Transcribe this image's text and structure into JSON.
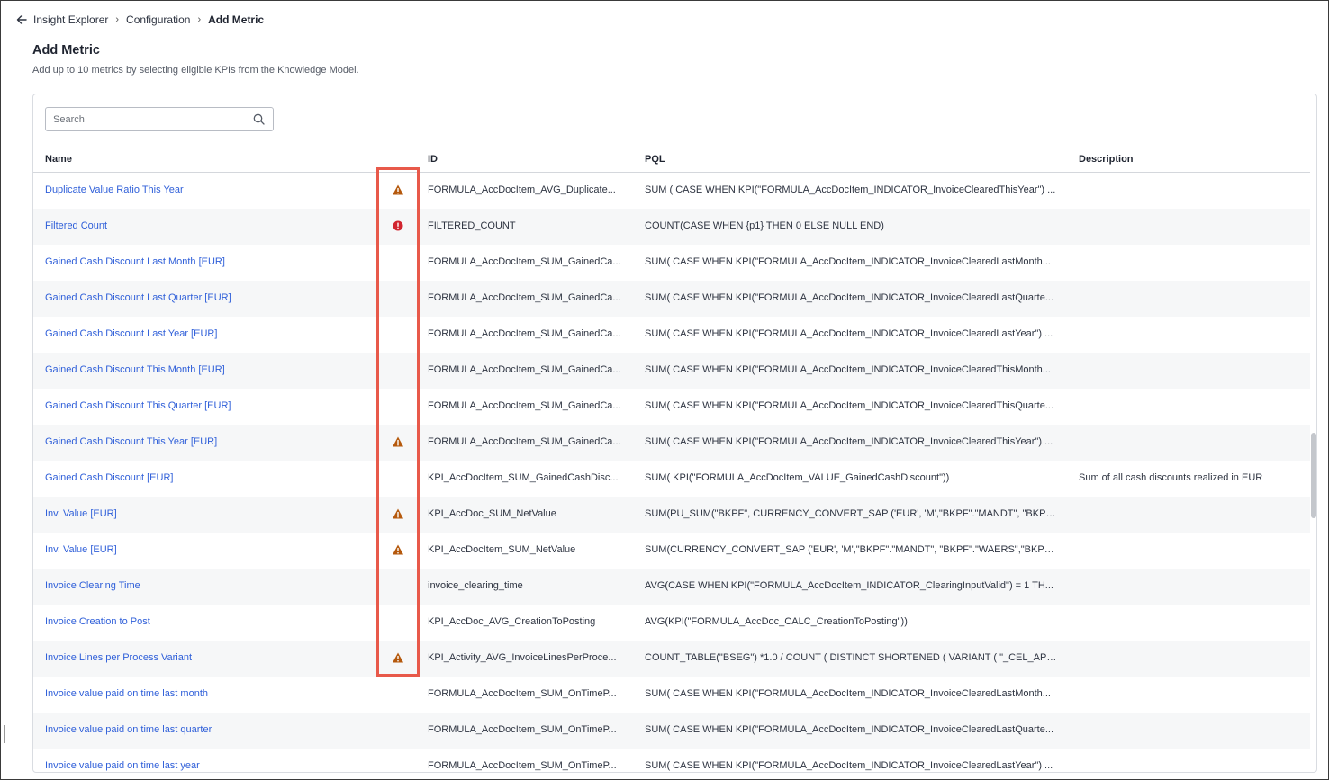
{
  "breadcrumb": {
    "items": [
      "Insight Explorer",
      "Configuration",
      "Add Metric"
    ]
  },
  "header": {
    "title": "Add Metric",
    "subtitle": "Add up to 10 metrics by selecting eligible KPIs from the Knowledge Model."
  },
  "search": {
    "placeholder": "Search",
    "value": ""
  },
  "table": {
    "columns": [
      "Name",
      "ID",
      "PQL",
      "Description"
    ],
    "rows": [
      {
        "name": "Duplicate Value Ratio This Year",
        "status": "warning",
        "id": "FORMULA_AccDocItem_AVG_Duplicate...",
        "pql": "SUM ( CASE WHEN KPI(\"FORMULA_AccDocItem_INDICATOR_InvoiceClearedThisYear\") ...",
        "description": ""
      },
      {
        "name": "Filtered Count",
        "status": "error",
        "id": "FILTERED_COUNT",
        "pql": "COUNT(CASE WHEN {p1} THEN 0 ELSE NULL END)",
        "description": ""
      },
      {
        "name": "Gained Cash Discount Last Month [EUR]",
        "status": "",
        "id": "FORMULA_AccDocItem_SUM_GainedCa...",
        "pql": "SUM( CASE WHEN KPI(\"FORMULA_AccDocItem_INDICATOR_InvoiceClearedLastMonth...",
        "description": ""
      },
      {
        "name": "Gained Cash Discount Last Quarter [EUR]",
        "status": "",
        "id": "FORMULA_AccDocItem_SUM_GainedCa...",
        "pql": "SUM( CASE WHEN KPI(\"FORMULA_AccDocItem_INDICATOR_InvoiceClearedLastQuarte...",
        "description": ""
      },
      {
        "name": "Gained Cash Discount Last Year [EUR]",
        "status": "",
        "id": "FORMULA_AccDocItem_SUM_GainedCa...",
        "pql": "SUM( CASE WHEN KPI(\"FORMULA_AccDocItem_INDICATOR_InvoiceClearedLastYear\") ...",
        "description": ""
      },
      {
        "name": "Gained Cash Discount This Month [EUR]",
        "status": "",
        "id": "FORMULA_AccDocItem_SUM_GainedCa...",
        "pql": "SUM( CASE WHEN KPI(\"FORMULA_AccDocItem_INDICATOR_InvoiceClearedThisMonth...",
        "description": ""
      },
      {
        "name": "Gained Cash Discount This Quarter [EUR]",
        "status": "",
        "id": "FORMULA_AccDocItem_SUM_GainedCa...",
        "pql": "SUM( CASE WHEN KPI(\"FORMULA_AccDocItem_INDICATOR_InvoiceClearedThisQuarte...",
        "description": ""
      },
      {
        "name": "Gained Cash Discount This Year [EUR]",
        "status": "warning",
        "id": "FORMULA_AccDocItem_SUM_GainedCa...",
        "pql": "SUM( CASE WHEN KPI(\"FORMULA_AccDocItem_INDICATOR_InvoiceClearedThisYear\") ...",
        "description": ""
      },
      {
        "name": "Gained Cash Discount [EUR]",
        "status": "",
        "id": "KPI_AccDocItem_SUM_GainedCashDisc...",
        "pql": "SUM( KPI(\"FORMULA_AccDocItem_VALUE_GainedCashDiscount\"))",
        "description": "Sum of all cash discounts realized in EUR"
      },
      {
        "name": "Inv. Value [EUR]",
        "status": "warning",
        "id": "KPI_AccDoc_SUM_NetValue",
        "pql": "SUM(PU_SUM(\"BKPF\", CURRENCY_CONVERT_SAP ('EUR', 'M',\"BKPF\".\"MANDT\", \"BKPF\".\"...",
        "description": ""
      },
      {
        "name": "Inv. Value [EUR]",
        "status": "warning",
        "id": "KPI_AccDocItem_SUM_NetValue",
        "pql": "SUM(CURRENCY_CONVERT_SAP ('EUR', 'M',\"BKPF\".\"MANDT\", \"BKPF\".\"WAERS\",\"BKPF\".\"...",
        "description": ""
      },
      {
        "name": "Invoice Clearing Time",
        "status": "",
        "id": "invoice_clearing_time",
        "pql": "AVG(CASE WHEN KPI(\"FORMULA_AccDocItem_INDICATOR_ClearingInputValid\") = 1 TH...",
        "description": ""
      },
      {
        "name": "Invoice Creation to Post",
        "status": "",
        "id": "KPI_AccDoc_AVG_CreationToPosting",
        "pql": "AVG(KPI(\"FORMULA_AccDoc_CALC_CreationToPosting\"))",
        "description": ""
      },
      {
        "name": "Invoice Lines per Process Variant",
        "status": "warning",
        "id": "KPI_Activity_AVG_InvoiceLinesPerProce...",
        "pql": "COUNT_TABLE(\"BSEG\") *1.0 / COUNT ( DISTINCT SHORTENED ( VARIANT ( \"_CEL_AP_...",
        "description": ""
      },
      {
        "name": "Invoice value paid on time last month",
        "status": "",
        "id": "FORMULA_AccDocItem_SUM_OnTimeP...",
        "pql": "SUM( CASE WHEN KPI(\"FORMULA_AccDocItem_INDICATOR_InvoiceClearedLastMonth...",
        "description": ""
      },
      {
        "name": "Invoice value paid on time last quarter",
        "status": "",
        "id": "FORMULA_AccDocItem_SUM_OnTimeP...",
        "pql": "SUM( CASE WHEN KPI(\"FORMULA_AccDocItem_INDICATOR_InvoiceClearedLastQuarte...",
        "description": ""
      },
      {
        "name": "Invoice value paid on time last year",
        "status": "",
        "id": "FORMULA_AccDocItem_SUM_OnTimeP...",
        "pql": "SUM( CASE WHEN KPI(\"FORMULA_AccDocItem_INDICATOR_InvoiceClearedLastYear\") ...",
        "description": ""
      }
    ]
  },
  "colors": {
    "link": "#2f5fd9",
    "warning": "#b5590d",
    "error": "#d1242f",
    "highlight": "#e8594a"
  },
  "icons": {
    "back": "arrow-left-icon",
    "search": "search-icon",
    "warning": "warning-triangle-icon",
    "error": "error-circle-icon"
  }
}
